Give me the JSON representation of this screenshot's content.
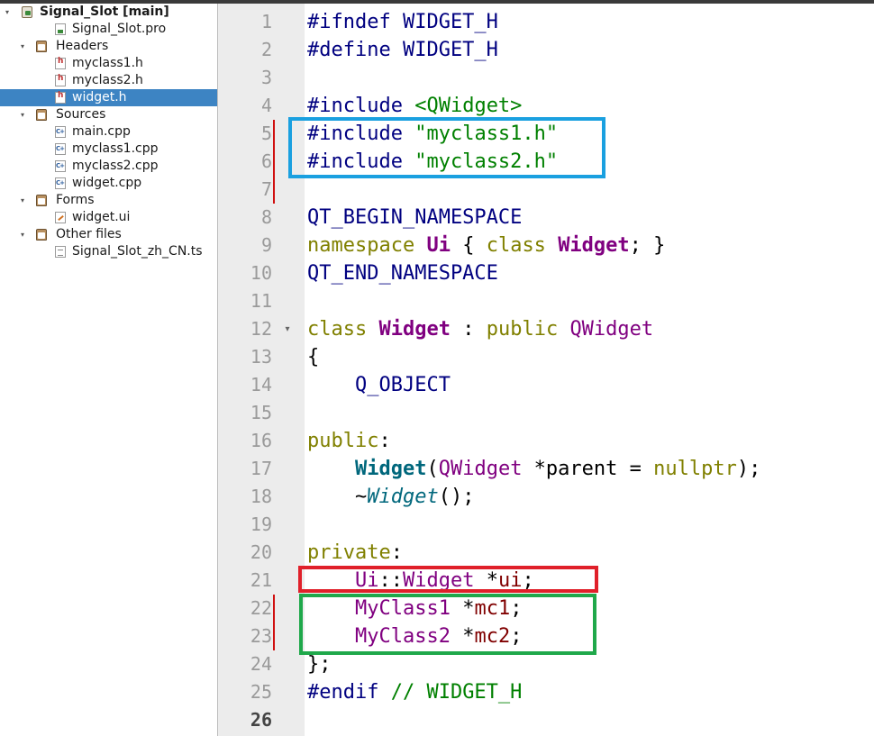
{
  "tree": {
    "items": [
      {
        "label": "Signal_Slot [main]",
        "icon": "project-icon"
      },
      {
        "label": "Signal_Slot.pro",
        "icon": "pro-file-icon"
      },
      {
        "label": "Headers",
        "icon": "headers-folder-icon"
      },
      {
        "label": "myclass1.h",
        "icon": "header-file-icon"
      },
      {
        "label": "myclass2.h",
        "icon": "header-file-icon"
      },
      {
        "label": "widget.h",
        "icon": "header-file-icon",
        "selected": true
      },
      {
        "label": "Sources",
        "icon": "sources-folder-icon"
      },
      {
        "label": "main.cpp",
        "icon": "cpp-file-icon"
      },
      {
        "label": "myclass1.cpp",
        "icon": "cpp-file-icon"
      },
      {
        "label": "myclass2.cpp",
        "icon": "cpp-file-icon"
      },
      {
        "label": "widget.cpp",
        "icon": "cpp-file-icon"
      },
      {
        "label": "Forms",
        "icon": "forms-folder-icon"
      },
      {
        "label": "widget.ui",
        "icon": "ui-file-icon"
      },
      {
        "label": "Other files",
        "icon": "other-files-folder-icon"
      },
      {
        "label": "Signal_Slot_zh_CN.ts",
        "icon": "ts-file-icon"
      }
    ]
  },
  "editor": {
    "current_line": 26,
    "line_numbers": [
      "1",
      "2",
      "3",
      "4",
      "5",
      "6",
      "7",
      "8",
      "9",
      "10",
      "11",
      "12",
      "13",
      "14",
      "15",
      "16",
      "17",
      "18",
      "19",
      "20",
      "21",
      "22",
      "23",
      "24",
      "25",
      "26"
    ],
    "lines": [
      [
        [
          "#ifndef WIDGET_H",
          "pp"
        ]
      ],
      [
        [
          "#define WIDGET_H",
          "pp"
        ]
      ],
      [],
      [
        [
          "#include ",
          "pp"
        ],
        [
          "<QWidget>",
          "str"
        ]
      ],
      [
        [
          "#include ",
          "pp"
        ],
        [
          "\"myclass1.h\"",
          "str"
        ]
      ],
      [
        [
          "#include ",
          "pp"
        ],
        [
          "\"myclass2.h\"",
          "str"
        ]
      ],
      [],
      [
        [
          "QT_BEGIN_NAMESPACE",
          "mac"
        ]
      ],
      [
        [
          "namespace ",
          "kw"
        ],
        [
          "Ui",
          "cls"
        ],
        [
          " { ",
          ""
        ],
        [
          "class ",
          "kw"
        ],
        [
          "Widget",
          "cls"
        ],
        [
          "; }",
          ""
        ]
      ],
      [
        [
          "QT_END_NAMESPACE",
          "mac"
        ]
      ],
      [],
      [
        [
          "class ",
          "kw"
        ],
        [
          "Widget",
          "cls"
        ],
        [
          " : ",
          ""
        ],
        [
          "public ",
          "kw"
        ],
        [
          "QWidget",
          "typ"
        ]
      ],
      [
        [
          "{",
          ""
        ]
      ],
      [
        [
          "    ",
          ""
        ],
        [
          "Q_OBJECT",
          "mac"
        ]
      ],
      [],
      [
        [
          "public",
          "kw"
        ],
        [
          ":",
          ""
        ]
      ],
      [
        [
          "    ",
          ""
        ],
        [
          "Widget",
          "fnb"
        ],
        [
          "(",
          ""
        ],
        [
          "QWidget",
          "typ"
        ],
        [
          " *parent = ",
          ""
        ],
        [
          "nullptr",
          "nul"
        ],
        [
          ");",
          ""
        ]
      ],
      [
        [
          "    ~",
          ""
        ],
        [
          "Widget",
          "fni"
        ],
        [
          "();",
          ""
        ]
      ],
      [],
      [
        [
          "private",
          "kw"
        ],
        [
          ":",
          ""
        ]
      ],
      [
        [
          "    ",
          ""
        ],
        [
          "Ui",
          "typ"
        ],
        [
          "::",
          ""
        ],
        [
          "Widget",
          "typ"
        ],
        [
          " *",
          ""
        ],
        [
          "ui",
          "mem"
        ],
        [
          ";",
          ""
        ]
      ],
      [
        [
          "    ",
          ""
        ],
        [
          "MyClass1",
          "typ"
        ],
        [
          " *",
          ""
        ],
        [
          "mc1",
          "mem"
        ],
        [
          ";",
          ""
        ]
      ],
      [
        [
          "    ",
          ""
        ],
        [
          "MyClass2",
          "typ"
        ],
        [
          " *",
          ""
        ],
        [
          "mc2",
          "mem"
        ],
        [
          ";",
          ""
        ]
      ],
      [
        [
          "};",
          ""
        ]
      ],
      [
        [
          "#endif ",
          "pp"
        ],
        [
          "// WIDGET_H",
          "cm"
        ]
      ],
      []
    ],
    "annotation_colors": {
      "includes_box": "#1aa0e0",
      "ui_box": "#e0202a",
      "members_box": "#1fa84a"
    }
  }
}
